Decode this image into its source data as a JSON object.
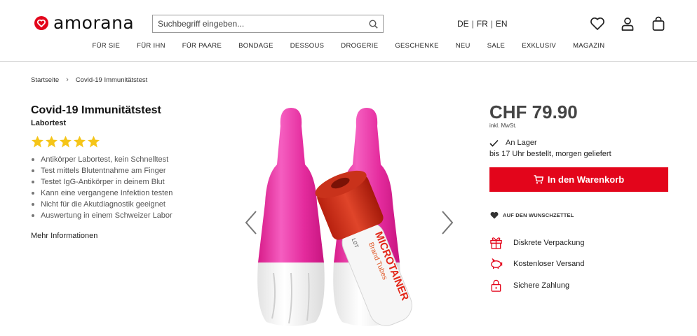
{
  "header": {
    "logo_text": "amorana",
    "search": {
      "placeholder": "Suchbegriff eingeben..."
    },
    "languages": [
      "DE",
      "FR",
      "EN"
    ],
    "nav": [
      "FÜR SIE",
      "FÜR IHN",
      "FÜR PAARE",
      "BONDAGE",
      "DESSOUS",
      "DROGERIE",
      "GESCHENKE",
      "NEU",
      "SALE",
      "EXKLUSIV",
      "MAGAZIN"
    ]
  },
  "breadcrumb": {
    "home": "Startseite",
    "current": "Covid-19 Immunitätstest"
  },
  "product": {
    "title": "Covid-19 Immunitätstest",
    "subtitle": "Labortest",
    "rating": 5,
    "bullets": [
      "Antikörper Labortest, kein Schnelltest",
      "Test mittels Blutentnahme am Finger",
      "Testet IgG-Antikörper in deinem Blut",
      "Kann eine vergangene Infektion testen",
      "Nicht für die Akutdiagnostik geeignet",
      "Auswertung in einem Schweizer Labor"
    ],
    "more_info": "Mehr Informationen",
    "image_text": {
      "microtainer": "MICROTAINER",
      "brand": "Brand Tubes",
      "lot": "LOT"
    }
  },
  "purchase": {
    "price": "CHF 79.90",
    "vat": "inkl. MwSt.",
    "stock": "An Lager",
    "delivery": "bis 17 Uhr bestellt, morgen geliefert",
    "cart_button": "In den Warenkorb",
    "wishlist": "AUF DEN WUNSCHZETTEL",
    "usps": [
      "Diskrete Verpackung",
      "Kostenloser Versand",
      "Sichere Zahlung"
    ]
  },
  "colors": {
    "accent": "#e3051b",
    "pink": "#e8289c",
    "text": "#222222"
  }
}
